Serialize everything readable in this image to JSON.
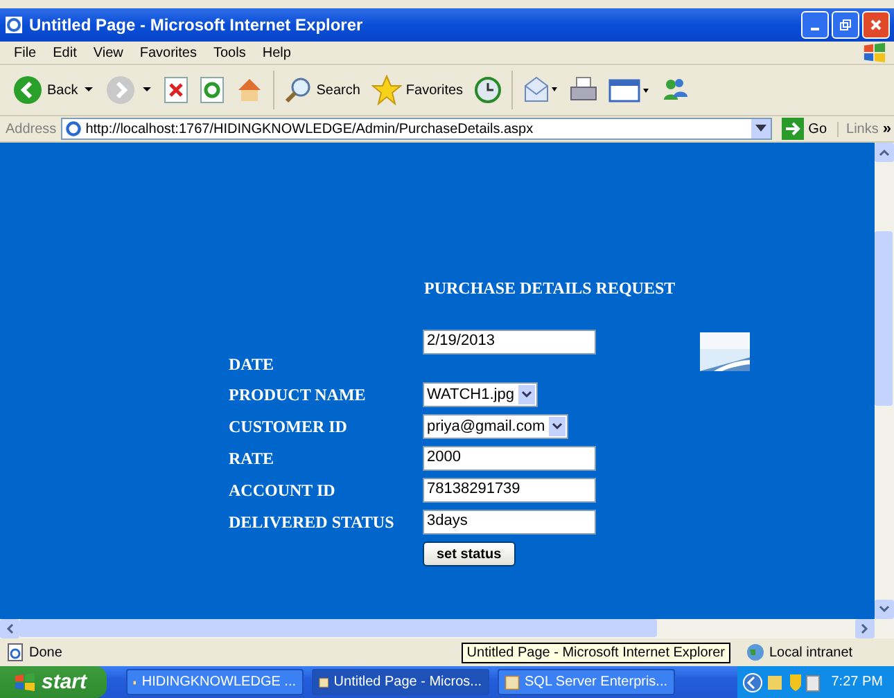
{
  "window": {
    "title": "Untitled Page - Microsoft Internet Explorer"
  },
  "menu": [
    "File",
    "Edit",
    "View",
    "Favorites",
    "Tools",
    "Help"
  ],
  "toolbar": [
    {
      "kind": "back",
      "label": "Back"
    },
    {
      "kind": "forward"
    },
    {
      "kind": "stop"
    },
    {
      "kind": "refresh"
    },
    {
      "kind": "home"
    },
    {
      "kind": "search",
      "label": "Search"
    },
    {
      "kind": "favorites",
      "label": "Favorites"
    },
    {
      "kind": "history"
    },
    {
      "kind": "mail"
    },
    {
      "kind": "print"
    },
    {
      "kind": "edit"
    },
    {
      "kind": "messenger"
    }
  ],
  "address_bar": {
    "label": "Address",
    "url": "http://localhost:1767/HIDINGKNOWLEDGE/Admin/PurchaseDetails.aspx",
    "go": "Go",
    "links": "Links",
    "more": "»"
  },
  "form": {
    "heading": "PURCHASE DETAILS REQUEST",
    "fields": [
      {
        "kind": "text",
        "label": "DATE",
        "value": "2/19/2013"
      },
      {
        "kind": "select",
        "label": "PRODUCT NAME",
        "value": "WATCH1.jpg"
      },
      {
        "kind": "select",
        "label": "CUSTOMER ID",
        "value": "priya@gmail.com"
      },
      {
        "kind": "text",
        "label": "RATE",
        "value": "2000"
      },
      {
        "kind": "text",
        "label": "ACCOUNT ID",
        "value": "78138291739"
      },
      {
        "kind": "text",
        "label": "DELIVERED STATUS",
        "value": "3days"
      }
    ],
    "button": "set status"
  },
  "status_bar": {
    "text": "Done",
    "tooltip": "Untitled Page - Microsoft Internet Explorer",
    "zone": "Local intranet"
  },
  "taskbar": {
    "start": "start",
    "tasks": [
      {
        "label": "HIDINGKNOWLEDGE ...",
        "selected": false
      },
      {
        "label": "Untitled Page - Micros...",
        "selected": true
      },
      {
        "label": "SQL Server Enterpris...",
        "selected": false
      }
    ],
    "clock": "7:27 PM"
  }
}
